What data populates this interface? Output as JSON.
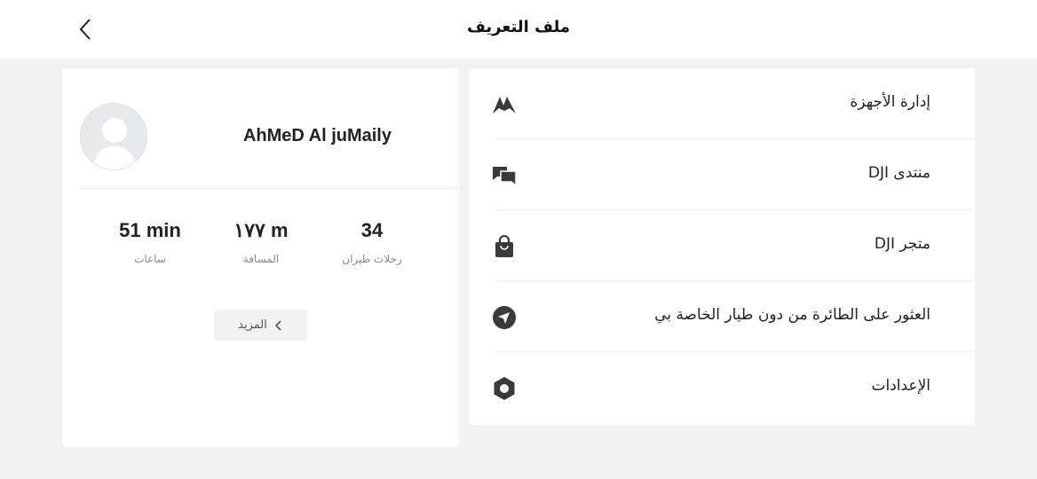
{
  "header": {
    "title": "ملف التعريف",
    "back_icon": "chevron-left-icon"
  },
  "profile": {
    "username": "AhMeD Al juMaily",
    "stats": [
      {
        "value": "51 min",
        "label": "ساعات"
      },
      {
        "value": "١٧٧ m",
        "label": "المسافة"
      },
      {
        "value": "34",
        "label": "رحلات طيران"
      }
    ],
    "more_label": "المزيد"
  },
  "menu": {
    "items": [
      {
        "label": "إدارة الأجهزة",
        "icon": "device-management-icon"
      },
      {
        "label": "منتدى DJI",
        "icon": "forum-chat-icon"
      },
      {
        "label": "متجر DJI",
        "icon": "store-bag-icon"
      },
      {
        "label": "العثور على الطائرة من دون طيار الخاصة بي",
        "icon": "find-drone-compass-icon"
      },
      {
        "label": "الإعدادات",
        "icon": "settings-hex-icon"
      }
    ]
  },
  "colors": {
    "background": "#f2f2f3",
    "card": "#ffffff",
    "icon": "#3a3a3a",
    "muted_text": "#8a8a8a"
  }
}
